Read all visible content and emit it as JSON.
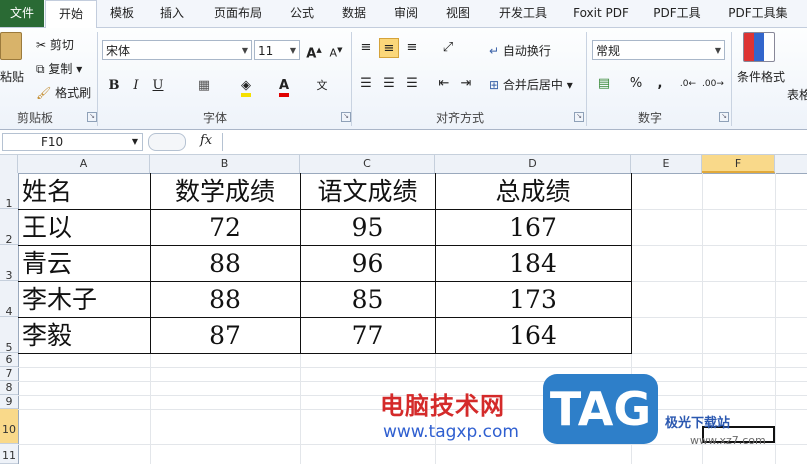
{
  "ribbon_tabs": [
    "文件",
    "开始",
    "模板",
    "插入",
    "页面布局",
    "公式",
    "数据",
    "审阅",
    "视图",
    "开发工具",
    "Foxit PDF",
    "PDF工具",
    "PDF工具集"
  ],
  "clipboard": {
    "paste": "粘贴",
    "cut": "剪切",
    "copy": "复制",
    "format_painter": "格式刷",
    "group": "剪贴板"
  },
  "font": {
    "name": "宋体",
    "size": "11",
    "bold": "B",
    "italic": "I",
    "underline": "U",
    "group": "字体"
  },
  "alignment": {
    "wrap_text": "自动换行",
    "merge_center": "合并后居中",
    "group": "对齐方式"
  },
  "number": {
    "format": "常规",
    "percent": "%",
    "comma": ",",
    "group": "数字"
  },
  "styles": {
    "conditional_format": "条件格式",
    "table_format": "表格"
  },
  "formula_bar": {
    "name_box": "F10",
    "fx": "fx",
    "value": ""
  },
  "columns": [
    "A",
    "B",
    "C",
    "D",
    "E",
    "F"
  ],
  "selected_column": "F",
  "rows": [
    "1",
    "2",
    "3",
    "4",
    "5",
    "6",
    "7",
    "8",
    "9",
    "10",
    "11"
  ],
  "table": {
    "headers": [
      "姓名",
      "数学成绩",
      "语文成绩",
      "总成绩"
    ],
    "data": [
      [
        "王以",
        "72",
        "95",
        "167"
      ],
      [
        "青云",
        "88",
        "96",
        "184"
      ],
      [
        "李木子",
        "88",
        "85",
        "173"
      ],
      [
        "李毅",
        "87",
        "77",
        "164"
      ]
    ]
  },
  "watermark": {
    "cn": "电脑技术网",
    "url": "www.tagxp.com",
    "tag": "TAG",
    "site": "极光下载站",
    "site_url": "www.xz7.com"
  },
  "colors": {
    "file_tab": "#2a6a34",
    "selected_header": "#f9d98a",
    "watermark_red": "#d42a2a",
    "watermark_blue": "#2e7fc9"
  }
}
